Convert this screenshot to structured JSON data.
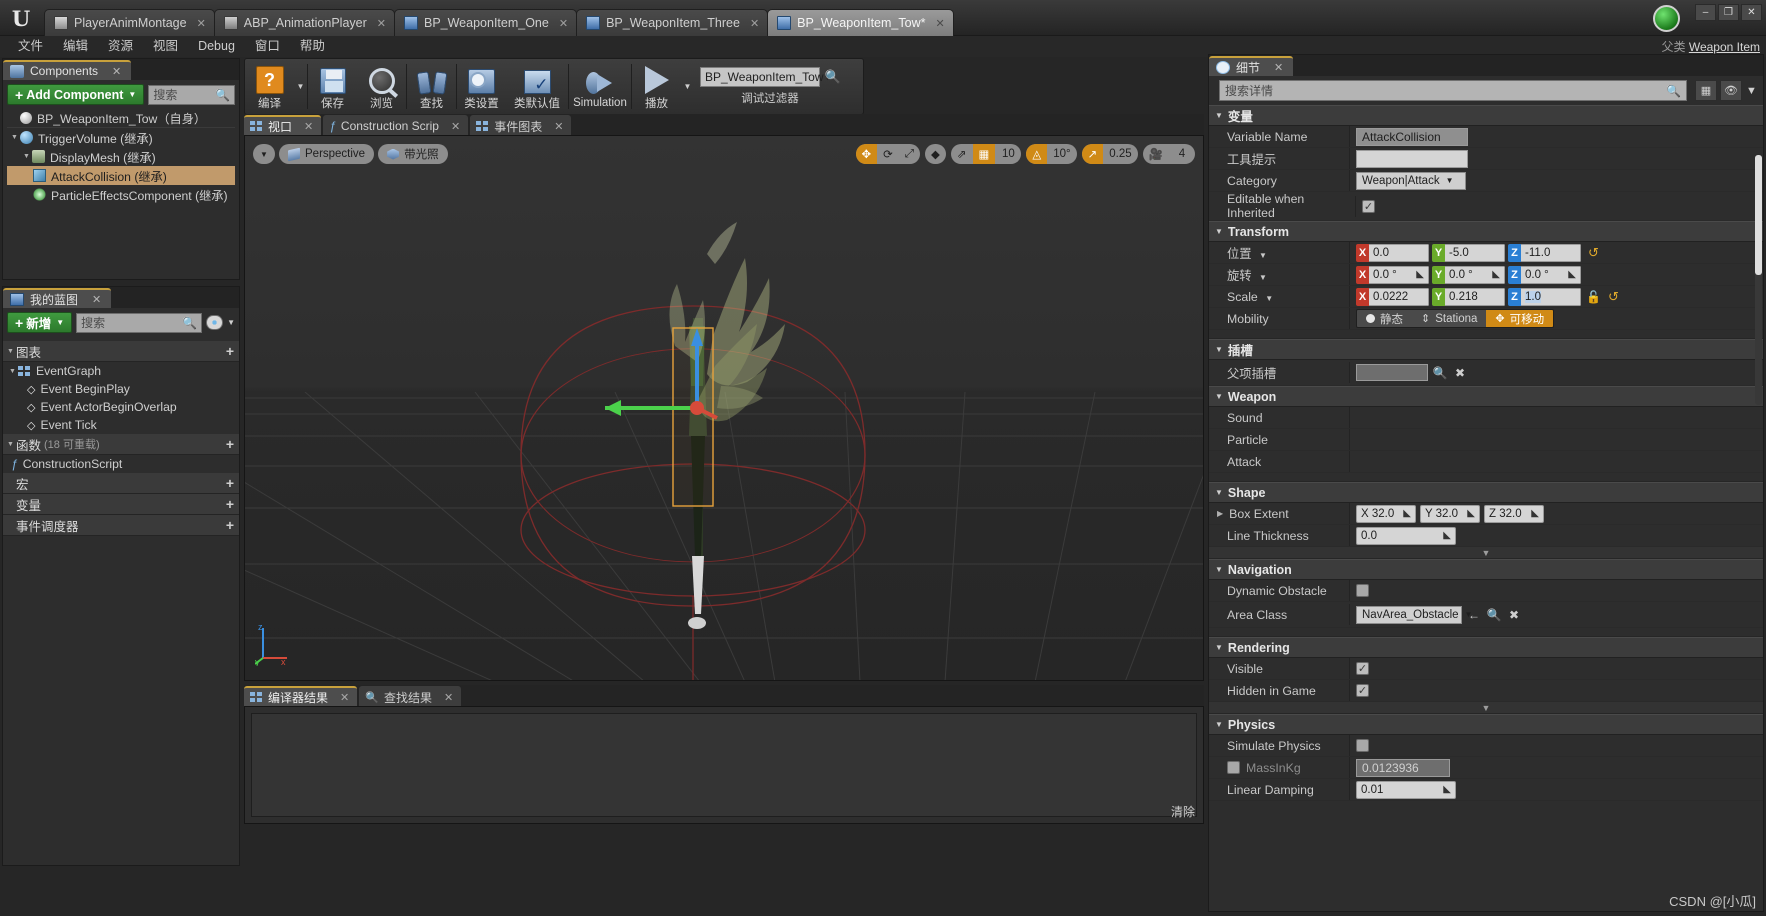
{
  "window": {
    "doc_tabs": [
      {
        "label": "PlayerAnimMontage",
        "icon": "montage-icon",
        "active": false
      },
      {
        "label": "ABP_AnimationPlayer",
        "icon": "anim-icon",
        "active": false
      },
      {
        "label": "BP_WeaponItem_One",
        "icon": "blueprint-icon",
        "active": false
      },
      {
        "label": "BP_WeaponItem_Three",
        "icon": "blueprint-icon",
        "active": false
      },
      {
        "label": "BP_WeaponItem_Tow*",
        "icon": "blueprint-icon",
        "active": true
      }
    ],
    "minimize": "–",
    "maximize": "❐",
    "close": "✕"
  },
  "menubar": {
    "items": [
      "文件",
      "编辑",
      "资源",
      "视图",
      "Debug",
      "窗口",
      "帮助"
    ],
    "parent_class_label": "父类",
    "parent_class_value": "Weapon Item"
  },
  "toolbar": {
    "items": [
      {
        "label": "编译",
        "icon": "compile-icon",
        "has_caret": true
      },
      {
        "label": "保存",
        "icon": "save-icon",
        "has_caret": false
      },
      {
        "label": "浏览",
        "icon": "browse-icon",
        "has_caret": false
      },
      {
        "label": "查找",
        "icon": "find-icon",
        "has_caret": false
      },
      {
        "label": "类设置",
        "icon": "class-settings-icon",
        "has_caret": false
      },
      {
        "label": "类默认值",
        "icon": "class-defaults-icon",
        "has_caret": false
      },
      {
        "label": "Simulation",
        "icon": "simulation-icon",
        "has_caret": false
      },
      {
        "label": "播放",
        "icon": "play-icon",
        "has_caret": true
      }
    ],
    "debug_filter_value": "BP_WeaponItem_Tow",
    "debug_filter_label": "调试过滤器"
  },
  "components": {
    "tab_title": "Components",
    "tab_close": "✕",
    "add_button": "Add Component",
    "add_plus": "+",
    "search_placeholder": "搜索",
    "root": "BP_WeaponItem_Tow（自身）",
    "tree": [
      {
        "label": "TriggerVolume (继承)",
        "depth": 0,
        "icon": "sphere-icon",
        "selected": false,
        "expander": "▾"
      },
      {
        "label": "DisplayMesh (继承)",
        "depth": 1,
        "icon": "mesh-icon",
        "selected": false,
        "expander": "▾"
      },
      {
        "label": "AttackCollision (继承)",
        "depth": 2,
        "icon": "box-icon",
        "selected": true,
        "expander": ""
      },
      {
        "label": "ParticleEffectsComponent (继承)",
        "depth": 2,
        "icon": "particle-icon",
        "selected": false,
        "expander": ""
      }
    ]
  },
  "myblueprint": {
    "tab_title": "我的蓝图",
    "tab_close": "✕",
    "add_button": "新增",
    "add_plus": "+",
    "search_placeholder": "搜索",
    "sections": [
      {
        "title": "图表",
        "sub": "",
        "plus": "+",
        "items": [
          {
            "label": "EventGraph",
            "icon": "graph-icon",
            "depth": 0,
            "expander": "▾"
          },
          {
            "label": "Event BeginPlay",
            "icon": "event-icon",
            "depth": 1,
            "expander": ""
          },
          {
            "label": "Event ActorBeginOverlap",
            "icon": "event-icon",
            "depth": 1,
            "expander": ""
          },
          {
            "label": "Event Tick",
            "icon": "event-icon",
            "depth": 1,
            "expander": ""
          }
        ]
      },
      {
        "title": "函数",
        "sub": "(18 可重载)",
        "plus": "+",
        "items": [
          {
            "label": "ConstructionScript",
            "icon": "function-icon",
            "depth": 0,
            "expander": ""
          }
        ]
      },
      {
        "title": "宏",
        "sub": "",
        "plus": "+",
        "items": []
      },
      {
        "title": "变量",
        "sub": "",
        "plus": "+",
        "items": []
      },
      {
        "title": "事件调度器",
        "sub": "",
        "plus": "+",
        "items": []
      }
    ]
  },
  "center": {
    "tabs": [
      {
        "label": "视口",
        "icon": "viewport-icon",
        "active": true,
        "close": "✕"
      },
      {
        "label": "Construction Scrip",
        "icon": "function-icon",
        "active": false,
        "close": "✕"
      },
      {
        "label": "事件图表",
        "icon": "graph-icon",
        "active": false,
        "close": "✕"
      }
    ],
    "viewport_toolbar_left": [
      {
        "label": "",
        "icon": "chevron-down-icon"
      },
      {
        "label": "Perspective",
        "icon": "perspective-icon"
      },
      {
        "label": "带光照",
        "icon": "lit-icon"
      }
    ],
    "viewport_toolbar_right": {
      "transform_modes": [
        {
          "icon": "move-icon",
          "active": true
        },
        {
          "icon": "rotate-icon",
          "active": false
        },
        {
          "icon": "scale-icon",
          "active": false
        }
      ],
      "coord_space": {
        "icon": "world-space-icon"
      },
      "surface_snap": {
        "icon": "surface-snap-icon",
        "active": false
      },
      "grid_snap": {
        "icon": "grid-snap-icon",
        "active": true,
        "value": "10"
      },
      "rotation_snap": {
        "icon": "angle-snap-icon",
        "active": true,
        "value": "10°"
      },
      "scale_snap": {
        "icon": "scale-snap-icon",
        "active": true,
        "value": "0.25"
      },
      "camera_speed": {
        "icon": "camera-icon",
        "active": false,
        "value": "4"
      }
    },
    "axis_labels": {
      "x": "x",
      "y": "y",
      "z": "z"
    }
  },
  "results": {
    "tabs": [
      {
        "label": "编译器结果",
        "icon": "compiler-icon",
        "active": true,
        "close": "✕"
      },
      {
        "label": "查找结果",
        "icon": "search-icon",
        "active": false,
        "close": "✕"
      }
    ],
    "clear_label": "清除"
  },
  "details": {
    "tab_title": "细节",
    "tab_close": "✕",
    "search_placeholder": "搜索详情",
    "view_options_icon": "grid-view-icon",
    "eye_icon": "eye-icon",
    "sections": [
      {
        "title": "变量",
        "rows": [
          {
            "label": "Variable Name",
            "type": "text",
            "value": "AttackCollision",
            "style": "gray"
          },
          {
            "label": "工具提示",
            "type": "text",
            "value": "",
            "style": "light"
          },
          {
            "label": "Category",
            "type": "select",
            "value": "Weapon|Attack"
          },
          {
            "label": "Editable when Inherited",
            "type": "checkbox",
            "checked": true
          }
        ]
      },
      {
        "title": "Transform",
        "rows": [
          {
            "label": "位置",
            "type": "vector",
            "has_dropdown": true,
            "x": "0.0",
            "y": "-5.0",
            "z": "-11.0",
            "revert": true
          },
          {
            "label": "旋转",
            "type": "vector",
            "has_dropdown": true,
            "x": "0.0 °",
            "y": "0.0 °",
            "z": "0.0 °",
            "spinners": true
          },
          {
            "label": "Scale",
            "type": "vector",
            "has_dropdown": true,
            "x": "0.0222",
            "y": "0.218",
            "z": "1.0",
            "lock": true,
            "revert": true,
            "z_selected": true
          },
          {
            "label": "Mobility",
            "type": "mobility",
            "options": [
              {
                "label": "静态",
                "icon": "static-icon",
                "active": false
              },
              {
                "label": "Stationa",
                "icon": "stationary-icon",
                "active": false
              },
              {
                "label": "可移动",
                "icon": "movable-icon",
                "active": true
              }
            ]
          }
        ]
      },
      {
        "title": "插槽",
        "rows": [
          {
            "label": "父项插槽",
            "type": "socket",
            "value": "",
            "buttons": [
              "search-icon",
              "clear-icon"
            ]
          }
        ]
      },
      {
        "title": "Weapon",
        "rows": [
          {
            "label": "Sound",
            "type": "empty"
          },
          {
            "label": "Particle",
            "type": "empty"
          },
          {
            "label": "Attack",
            "type": "empty"
          }
        ]
      },
      {
        "title": "Shape",
        "rows": [
          {
            "label": "Box Extent",
            "type": "xyz-plain",
            "expander": "▷",
            "x": "X  32.0",
            "y": "Y  32.0",
            "z": "Z  32.0"
          },
          {
            "label": "Line Thickness",
            "type": "number",
            "value": "0.0"
          }
        ],
        "expander_after": true
      },
      {
        "title": "Navigation",
        "rows": [
          {
            "label": "Dynamic Obstacle",
            "type": "checkbox",
            "checked": false
          },
          {
            "label": "Area Class",
            "type": "select-wide",
            "value": "NavArea_Obstacle",
            "buttons": [
              "back-icon",
              "search-icon",
              "clear-icon"
            ]
          }
        ]
      },
      {
        "title": "Rendering",
        "rows": [
          {
            "label": "Visible",
            "type": "checkbox",
            "checked": true
          },
          {
            "label": "Hidden in Game",
            "type": "checkbox",
            "checked": true
          }
        ],
        "expander_after": true
      },
      {
        "title": "Physics",
        "rows": [
          {
            "label": "Simulate Physics",
            "type": "checkbox",
            "checked": false
          },
          {
            "label": "MassInKg",
            "type": "text-dim",
            "value": "0.0123936",
            "has_checkbox": true
          },
          {
            "label": "Linear Damping",
            "type": "number",
            "value": "0.01"
          }
        ]
      }
    ]
  },
  "watermark": "CSDN @[小瓜]"
}
